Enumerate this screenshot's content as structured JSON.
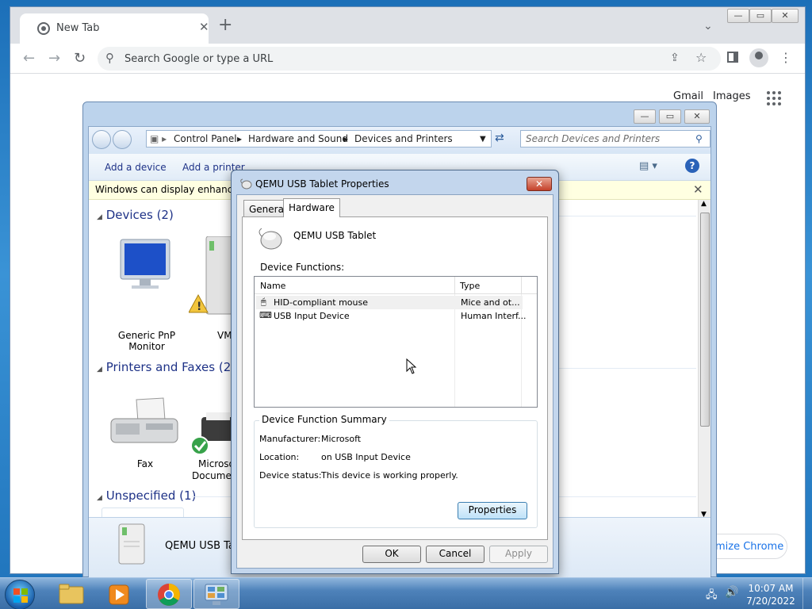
{
  "chrome": {
    "tab_title": "New Tab",
    "tab_close": "✕",
    "new_tab": "+",
    "tab_search": "⌄",
    "omnibox_placeholder": "Search Google or type a URL",
    "gmail": "Gmail",
    "images": "Images",
    "customize": "mize Chrome"
  },
  "explorer": {
    "breadcrumb": [
      "Control Panel",
      "Hardware and Sound",
      "Devices and Printers"
    ],
    "search_placeholder": "Search Devices and Printers",
    "commands": {
      "add_device": "Add a device",
      "add_printer": "Add a printer"
    },
    "infobar": "Windows can display enhanced d",
    "groups": {
      "devices": "Devices (2)",
      "printers": "Printers and Faxes (2)",
      "unspecified": "Unspecified (1)"
    },
    "items": {
      "monitor": "Generic PnP Monitor",
      "vm": "VM",
      "fax": "Fax",
      "xps_1": "Microso",
      "xps_2": "Documen"
    },
    "details_name": "QEMU USB Ta"
  },
  "dialog": {
    "title": "QEMU USB Tablet Properties",
    "tabs": {
      "general": "General",
      "hardware": "Hardware"
    },
    "device_name": "QEMU USB Tablet",
    "functions_label": "Device Functions:",
    "columns": {
      "name": "Name",
      "type": "Type"
    },
    "rows": [
      {
        "name": "HID-compliant mouse",
        "type": "Mice and ot..."
      },
      {
        "name": "USB Input Device",
        "type": "Human Interf..."
      }
    ],
    "summary": {
      "legend": "Device Function Summary",
      "manufacturer_label": "Manufacturer:",
      "manufacturer": "Microsoft",
      "location_label": "Location:",
      "location": "on USB Input Device",
      "status_label": "Device status:",
      "status": "This device is working properly.",
      "properties_button": "Properties"
    },
    "buttons": {
      "ok": "OK",
      "cancel": "Cancel",
      "apply": "Apply"
    }
  },
  "taskbar": {
    "time": "10:07 AM",
    "date": "7/20/2022"
  },
  "colors": {
    "desktop": "#2a7cc4",
    "link_blue": "#1e3287",
    "chrome_tabbar": "#dee1e6"
  }
}
